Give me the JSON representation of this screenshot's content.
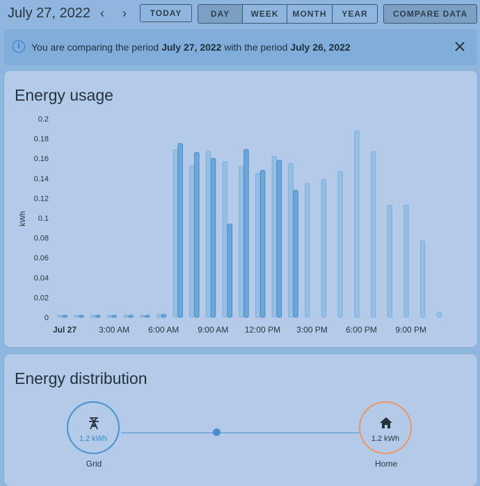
{
  "toolbar": {
    "date": "July 27, 2022",
    "prev_icon": "chevron-left-icon",
    "next_icon": "chevron-right-icon",
    "today_label": "TODAY",
    "periods": [
      "DAY",
      "WEEK",
      "MONTH",
      "YEAR"
    ],
    "active_period": "DAY",
    "compare_label": "COMPARE DATA"
  },
  "banner": {
    "icon": "info-icon",
    "text_prefix": "You are comparing the period ",
    "period_current": "July 27, 2022",
    "text_middle": " with the period ",
    "period_compare": "July 26, 2022",
    "close_icon": "close-icon"
  },
  "usage": {
    "title": "Energy usage",
    "colors": {
      "compare": "#97bee3",
      "current": "#6da6d8",
      "compare_stroke": "#7eaedb",
      "current_stroke": "#4a8ac4"
    }
  },
  "chart_data": {
    "type": "bar",
    "ylabel": "kWh",
    "ylim": [
      0,
      0.2
    ],
    "y_ticks": [
      "0.2",
      "0.18",
      "0.16",
      "0.14",
      "0.12",
      "0.1",
      "0.08",
      "0.06",
      "0.04",
      "0.02",
      "0"
    ],
    "x_tick_labels": [
      "Jul 27",
      "3:00 AM",
      "6:00 AM",
      "9:00 AM",
      "12:00 PM",
      "3:00 PM",
      "6:00 PM",
      "9:00 PM"
    ],
    "categories": [
      "0",
      "1",
      "2",
      "3",
      "4",
      "5",
      "6",
      "7",
      "8",
      "9",
      "10",
      "11",
      "12",
      "13",
      "14",
      "15",
      "16",
      "17",
      "18",
      "19",
      "20",
      "21",
      "22",
      "23"
    ],
    "series": [
      {
        "role": "compare",
        "values": [
          0.002,
          0.002,
          0.002,
          0.002,
          0.002,
          0.002,
          0.003,
          0.169,
          0.153,
          0.167,
          0.157,
          0.152,
          0.145,
          0.162,
          0.155,
          0.135,
          0.139,
          0.147,
          0.188,
          0.167,
          0.113,
          0.113,
          0.077,
          0.005
        ]
      },
      {
        "role": "current",
        "values": [
          0.002,
          0.002,
          0.002,
          0.002,
          0.002,
          0.002,
          0.003,
          0.175,
          0.166,
          0.16,
          0.094,
          0.169,
          0.148,
          0.158,
          0.128
        ]
      }
    ]
  },
  "distribution": {
    "title": "Energy distribution",
    "grid": {
      "label": "Grid",
      "value": "1.2 kWh",
      "icon": "transmission-tower-icon"
    },
    "home": {
      "label": "Home",
      "value": "1.2 kWh",
      "icon": "home-icon"
    }
  }
}
